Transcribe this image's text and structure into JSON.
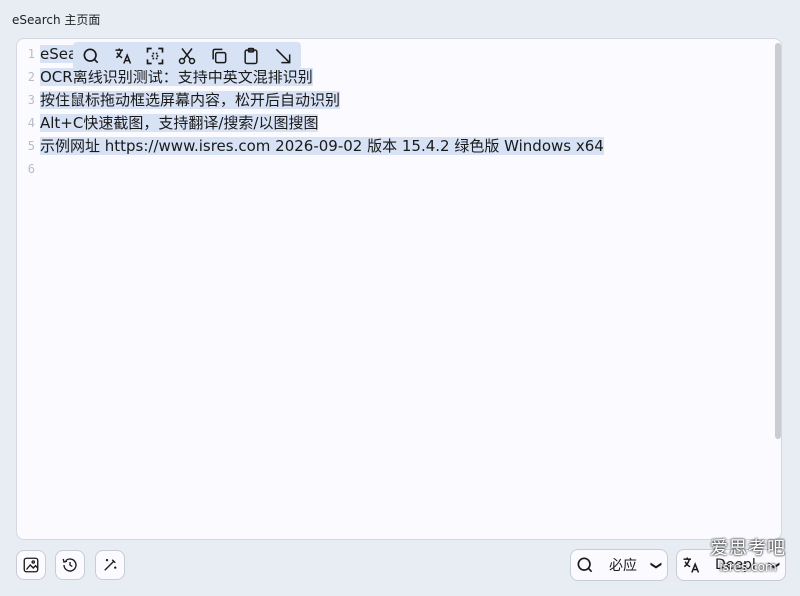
{
  "window": {
    "title": "eSearch 主页面"
  },
  "editor": {
    "line_numbers": [
      "1",
      "2",
      "3",
      "4",
      "5",
      "6"
    ],
    "lines": [
      "eSea",
      "OCR离线识别测试：支持中英文混排识别",
      "按住鼠标拖动框选屏幕内容，松开后自动识别",
      "Alt+C快速截图，支持翻译/搜索/以图搜图",
      "示例网址 https://www.isres.com 2026-09-02 版本 15.4.2 绿色版 Windows x64",
      ""
    ]
  },
  "floating_toolbar": {
    "icons": [
      "search-icon",
      "translate-icon",
      "scan-icon",
      "cut-icon",
      "copy-icon",
      "paste-icon",
      "close-arrow-icon"
    ]
  },
  "bottom": {
    "search_engine": "必应",
    "translate_engine": "Deepl"
  },
  "watermark": {
    "line1": "爱思考吧",
    "line2": "isres.com"
  },
  "colors": {
    "selection": "#d7e2f5",
    "background": "#e8edf4"
  }
}
